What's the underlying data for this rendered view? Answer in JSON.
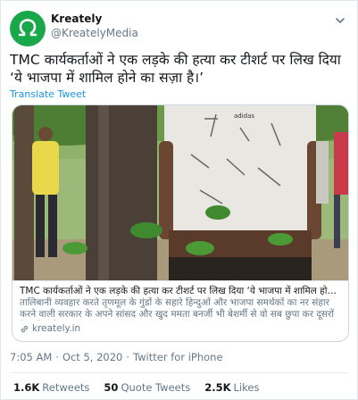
{
  "author": {
    "name": "Kreately",
    "handle": "@KreatelyMedia",
    "avatar_color": "#18a84a"
  },
  "tweet": {
    "text": "TMC कार्यकर्ताओं ने एक लड़के की हत्या कर टीशर्ट पर लिख दिया ‘ये भाजपा में शामिल होने का सज़ा है।’",
    "translate_label": "Translate Tweet"
  },
  "card": {
    "title": "TMC कार्यकर्ताओं ने एक लड़के की हत्या कर टीशर्ट पर लिख दिया ‘ये भाजपा में शामिल होने का स...",
    "description": "तालिबानी व्यवहार करते तृणमूल के गुंडों के सहारे हिन्दुओं और भाजपा समर्थकों का नर संहार करने वाली सरकार के अपने सांसद और खुद ममता बनर्जी भी बेशर्मी से वो सब छुपा कर दूसरों के घरों /प्रदे...",
    "domain": "kreately.in",
    "shirt_brand": "adidas"
  },
  "meta": {
    "time": "7:05 AM",
    "sep1": "·",
    "date": "Oct 5, 2020",
    "sep2": "·",
    "source": "Twitter for iPhone"
  },
  "stats": {
    "retweets_count": "1.6K",
    "retweets_label": "Retweets",
    "quotes_count": "50",
    "quotes_label": "Quote Tweets",
    "likes_count": "2.5K",
    "likes_label": "Likes"
  },
  "colors": {
    "link_blue": "#1b95e0",
    "secondary_gray": "#657786",
    "border": "#ccd6dd"
  },
  "icons": {
    "avatar_logo": "kreately-omega-logo",
    "more": "chevron-down-icon",
    "domain": "link-icon"
  }
}
